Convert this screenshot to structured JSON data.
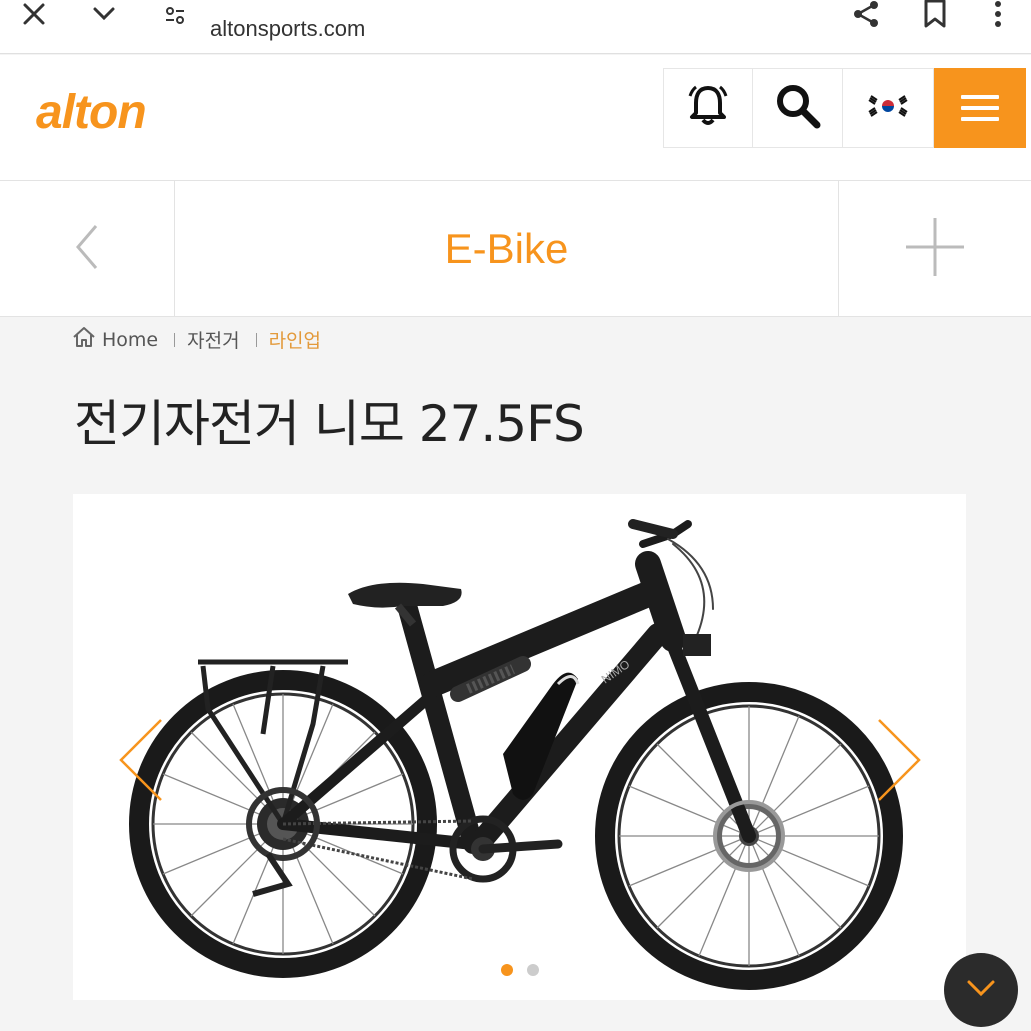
{
  "browser": {
    "url": "altonsports.com",
    "icons": [
      "close-icon",
      "chevron-down-icon",
      "site-settings-icon",
      "share-icon",
      "bookmark-icon",
      "more-vert-icon"
    ]
  },
  "header": {
    "logo": "alton",
    "icons": [
      "bell-icon",
      "search-icon",
      "korea-flag-icon",
      "hamburger-menu-icon"
    ],
    "brand_color": "#f7941d"
  },
  "category": {
    "title": "E-Bike",
    "icons": [
      "chevron-left-icon",
      "plus-icon"
    ]
  },
  "breadcrumb": {
    "home": "Home",
    "level1": "자전거",
    "level2": "라인업"
  },
  "product": {
    "title": "전기자전거 니모 27.5FS",
    "frame_text": "NIMO",
    "slide_count": 2,
    "active_slide": 1
  },
  "fab": {
    "icon": "chevron-down-icon"
  }
}
